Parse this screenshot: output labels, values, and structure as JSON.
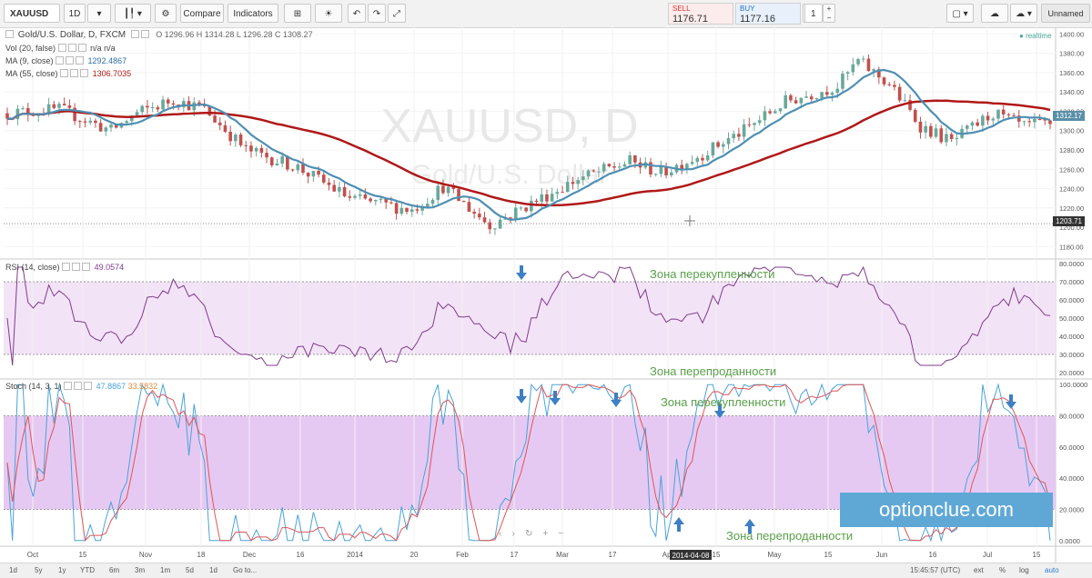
{
  "toolbar": {
    "symbol": "XAUUSD",
    "interval": "1D",
    "compare": "Compare",
    "indicators": "Indicators",
    "sell_label": "SELL",
    "sell_price": "1176.71",
    "buy_label": "BUY",
    "buy_price": "1177.16",
    "qty": "1",
    "layout_name": "Unnamed"
  },
  "main_pane": {
    "title": "Gold/U.S. Dollar, D, FXCM",
    "ohlc": "O 1296.96  H 1314.28  L 1296.28  C 1308.27",
    "watermark_symbol": "XAUUSD, D",
    "watermark_name": "Gold/U.S. Dollar",
    "realtime": "realtime",
    "indicators": [
      {
        "label": "Vol (20, false)",
        "value": "n/a  n/a",
        "color": "#444444"
      },
      {
        "label": "MA (9, close)",
        "value": "1292.4867",
        "color": "#2f6fa3"
      },
      {
        "label": "MA (55, close)",
        "value": "1306.7035",
        "color": "#b01818"
      }
    ],
    "price_ticks": [
      "1400.00",
      "1380.00",
      "1360.00",
      "1340.00",
      "1320.00",
      "1300.00",
      "1280.00",
      "1260.00",
      "1240.00",
      "1220.00",
      "1200.00",
      "1180.00"
    ],
    "last_price_tag": "1312.17",
    "cursor_price_tag": "1203.71"
  },
  "rsi_pane": {
    "label": "RSI (14, close)",
    "value": "49.0574",
    "ticks": [
      "80.0000",
      "70.0000",
      "60.0000",
      "50.0000",
      "40.0000",
      "30.0000",
      "20.0000"
    ],
    "zone_overbought": "Зона перекупленности",
    "zone_oversold": "Зона перепроданности"
  },
  "stoch_pane": {
    "label": "Stoch (14, 3, 1)",
    "k_value": "47.8867",
    "d_value": "33.5832",
    "ticks": [
      "100.0000",
      "80.0000",
      "60.0000",
      "40.0000",
      "20.0000",
      "0.0000"
    ],
    "zone_overbought": "Зона перекупленности",
    "zone_oversold": "Зона перепроданности"
  },
  "time_axis": {
    "labels": [
      "Oct",
      "15",
      "Nov",
      "18",
      "Dec",
      "16",
      "2014",
      "20",
      "Feb",
      "17",
      "Mar",
      "17",
      "Apr",
      "15",
      "May",
      "15",
      "Jun",
      "16",
      "Jul",
      "15"
    ],
    "cursor_date": "2014-04-08"
  },
  "bottom_bar": {
    "ranges": [
      "1d",
      "5y",
      "1y",
      "YTD",
      "6m",
      "3m",
      "1m",
      "5d",
      "1d",
      "Go to..."
    ],
    "time": "15:45:57 (UTC)",
    "options": [
      "ext",
      "%",
      "log",
      "auto"
    ]
  },
  "brand": "optionclue.com",
  "colors": {
    "bull": "#6aa89a",
    "bear": "#c0504d",
    "ma_fast": "#4f8fb3",
    "ma_slow": "#b01818",
    "rsi_line": "#7e3c8a",
    "rsi_band": "#f3e3f7",
    "stoch_band": "#e6c9f3",
    "stoch_k": "#4aa3d8",
    "stoch_d": "#e05555",
    "arrow": "#3d7fc4",
    "zone_text": "#5aa04a"
  }
}
